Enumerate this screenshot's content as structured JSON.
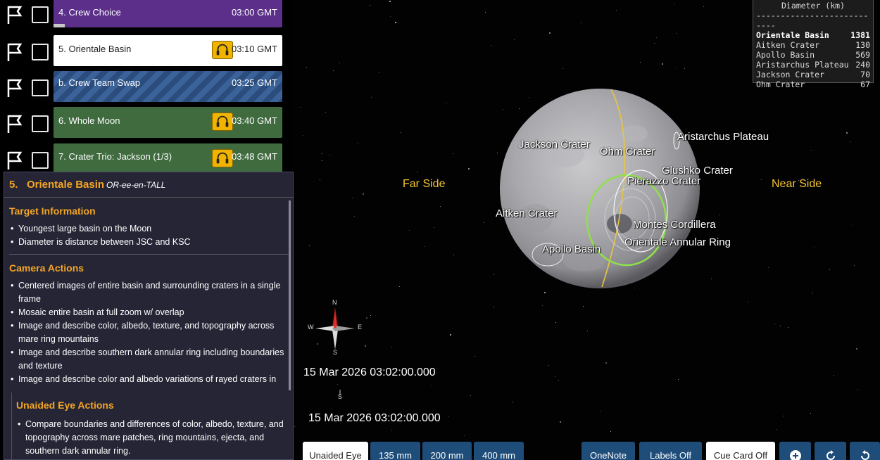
{
  "timeline": {
    "items": [
      {
        "label": "4. Crew Choice",
        "time": "03:00 GMT",
        "style": "purple",
        "audio": false
      },
      {
        "label": "5. Orientale Basin",
        "time": "03:10 GMT",
        "style": "white",
        "audio": true
      },
      {
        "label": "b. Crew Team Swap",
        "time": "03:25 GMT",
        "style": "stripe",
        "audio": false
      },
      {
        "label": "6. Whole Moon",
        "time": "03:40 GMT",
        "style": "green",
        "audio": true
      },
      {
        "label": "7. Crater Trio: Jackson (1/3)",
        "time": "03:48 GMT",
        "style": "green",
        "audio": true
      }
    ],
    "flag_icon": "flag-icon",
    "headphones_icon": "headphones-icon"
  },
  "cue_card": {
    "number": "5.",
    "title": "Orientale Basin",
    "pronunciation": "OR-ee-en-TALL",
    "target_heading": "Target Information",
    "target_items": [
      "Youngest large basin on the Moon",
      "Diameter is distance between JSC and KSC"
    ],
    "camera_heading": "Camera Actions",
    "camera_items": [
      "Centered images of entire basin and surrounding craters in a single frame",
      "Mosaic entire basin at full zoom w/ overlap",
      "Image and describe color, albedo, texture, and topography across mare ring mountains",
      "Image and describe southern dark annular ring including boundaries and texture",
      "Image and describe color and albedo variations of rayed craters in"
    ],
    "unaided_heading": "Unaided Eye Actions",
    "unaided_items": [
      "Compare boundaries and differences of color, albedo, texture, and topography across mare patches, ring mountains, ejecta, and southern dark annular ring."
    ]
  },
  "moon": {
    "labels": {
      "jackson": "Jackson Crater",
      "ohm": "Ohm Crater",
      "aristarchus": "Aristarchus Plateau",
      "glushko": "Glushko Crater",
      "pierazzo": "Pierazzo Crater",
      "aitken": "Aitken Crater",
      "montes": "Montes Cordillera",
      "orientale_ring": "Orientale Annular Ring",
      "apollo": "Apollo Basin"
    },
    "far_side": "Far Side",
    "near_side": "Near Side"
  },
  "diameter_table": {
    "header": "Diameter (km)",
    "dashes": "---------------------------",
    "rows": [
      {
        "name": "Orientale Basin",
        "value": "1381",
        "highlight": true
      },
      {
        "name": "Aitken Crater",
        "value": "130",
        "highlight": false
      },
      {
        "name": "Apollo Basin",
        "value": "569",
        "highlight": false
      },
      {
        "name": "Aristarchus Plateau",
        "value": "240",
        "highlight": false
      },
      {
        "name": "Jackson Crater",
        "value": "70",
        "highlight": false
      },
      {
        "name": "Ohm Crater",
        "value": "67",
        "highlight": false
      }
    ]
  },
  "compass": {
    "n": "N",
    "s": "S",
    "e": "E",
    "w": "W"
  },
  "timestamps": {
    "primary": "15 Mar 2026 03:02:00.000",
    "secondary": "15 Mar 2026 03:02:00.000",
    "secondary_compass_s": "S"
  },
  "buttons": {
    "unaided_eye": "Unaided Eye",
    "lens_135": "135 mm",
    "lens_200": "200 mm",
    "lens_400": "400 mm",
    "onenote": "OneNote",
    "labels_off": "Labels Off",
    "cue_card_off": "Cue Card Off"
  },
  "colors": {
    "accent": "#f4a623",
    "side_label": "#f4c430",
    "button_bg": "#1e4d7a",
    "headphones": "#f0b400"
  }
}
